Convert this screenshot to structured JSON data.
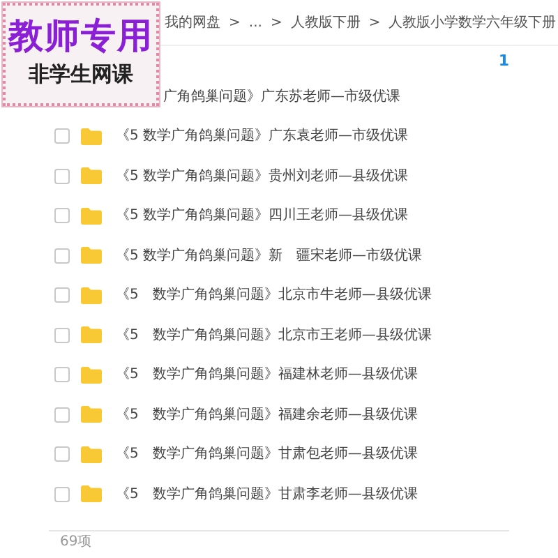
{
  "stamp": {
    "title": "教师专用",
    "subtitle": "非学生网课"
  },
  "breadcrumb": [
    {
      "label": "我的网盘"
    },
    {
      "label": "..."
    },
    {
      "label": "人教版下册"
    },
    {
      "label": "人教版小学数学六年级下册"
    }
  ],
  "breadcrumb_separator": ">",
  "toolbar_text": "1",
  "files": [
    {
      "kind": "covered",
      "name": "广角鸽巢问题》广东苏老师—市级优课"
    },
    {
      "kind": "folder",
      "name": "《5 数学广角鸽巢问题》广东袁老师—市级优课",
      "checked": false
    },
    {
      "kind": "folder",
      "name": "《5 数学广角鸽巢问题》贵州刘老师—县级优课",
      "checked": false
    },
    {
      "kind": "folder",
      "name": "《5 数学广角鸽巢问题》四川王老师—县级优课",
      "checked": false
    },
    {
      "kind": "folder",
      "name": "《5 数学广角鸽巢问题》新　疆宋老师—市级优课",
      "checked": false
    },
    {
      "kind": "folder",
      "name": "《5　数学广角鸽巢问题》北京市牛老师—县级优课",
      "checked": false
    },
    {
      "kind": "folder",
      "name": "《5　数学广角鸽巢问题》北京市王老师—县级优课",
      "checked": false
    },
    {
      "kind": "folder",
      "name": "《5　数学广角鸽巢问题》福建林老师—县级优课",
      "checked": false
    },
    {
      "kind": "folder",
      "name": "《5　数学广角鸽巢问题》福建余老师—县级优课",
      "checked": false
    },
    {
      "kind": "folder",
      "name": "《5　数学广角鸽巢问题》甘肃包老师—县级优课",
      "checked": false
    },
    {
      "kind": "folder",
      "name": "《5　数学广角鸽巢问题》甘肃李老师—县级优课",
      "checked": false
    }
  ],
  "footer": "69项"
}
